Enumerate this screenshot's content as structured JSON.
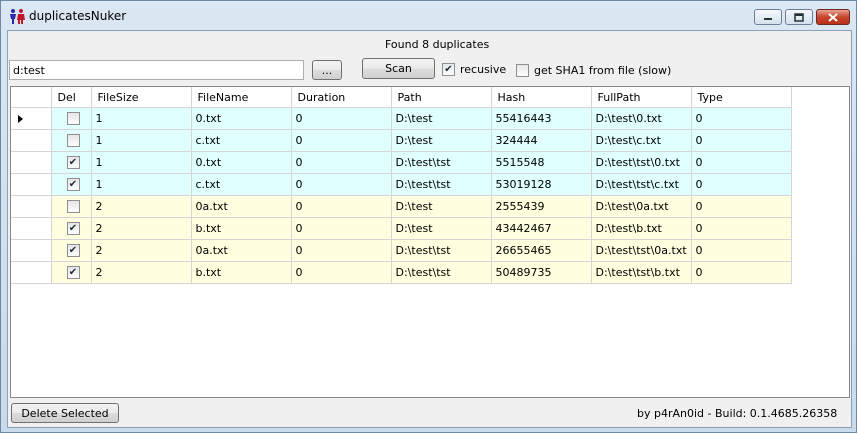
{
  "window": {
    "title": "duplicatesNuker"
  },
  "status": "Found 8 duplicates",
  "path_input": {
    "value": "d:test"
  },
  "browse_label": "...",
  "scan_label": "Scan",
  "options": {
    "recursive": {
      "label": "recusive",
      "checked": true
    },
    "sha1": {
      "label": "get SHA1 from file (slow)",
      "checked": false
    }
  },
  "grid": {
    "columns": [
      "Del",
      "FileSize",
      "FileName",
      "Duration",
      "Path",
      "Hash",
      "FullPath",
      "Type"
    ],
    "rows": [
      {
        "del": false,
        "size": "1",
        "name": "0.txt",
        "duration": "0",
        "path": "D:\\test",
        "hash": "55416443",
        "full": "D:\\test\\0.txt",
        "type": "0",
        "group": 1,
        "current": true
      },
      {
        "del": false,
        "size": "1",
        "name": "c.txt",
        "duration": "0",
        "path": "D:\\test",
        "hash": "324444",
        "full": "D:\\test\\c.txt",
        "type": "0",
        "group": 1,
        "current": false
      },
      {
        "del": true,
        "size": "1",
        "name": "0.txt",
        "duration": "0",
        "path": "D:\\test\\tst",
        "hash": "5515548",
        "full": "D:\\test\\tst\\0.txt",
        "type": "0",
        "group": 1,
        "current": false
      },
      {
        "del": true,
        "size": "1",
        "name": "c.txt",
        "duration": "0",
        "path": "D:\\test\\tst",
        "hash": "53019128",
        "full": "D:\\test\\tst\\c.txt",
        "type": "0",
        "group": 1,
        "current": false
      },
      {
        "del": false,
        "size": "2",
        "name": "0a.txt",
        "duration": "0",
        "path": "D:\\test",
        "hash": "2555439",
        "full": "D:\\test\\0a.txt",
        "type": "0",
        "group": 2,
        "current": false
      },
      {
        "del": true,
        "size": "2",
        "name": "b.txt",
        "duration": "0",
        "path": "D:\\test",
        "hash": "43442467",
        "full": "D:\\test\\b.txt",
        "type": "0",
        "group": 2,
        "current": false
      },
      {
        "del": true,
        "size": "2",
        "name": "0a.txt",
        "duration": "0",
        "path": "D:\\test\\tst",
        "hash": "26655465",
        "full": "D:\\test\\tst\\0a.txt",
        "type": "0",
        "group": 2,
        "current": false
      },
      {
        "del": true,
        "size": "2",
        "name": "b.txt",
        "duration": "0",
        "path": "D:\\test\\tst",
        "hash": "50489735",
        "full": "D:\\test\\tst\\b.txt",
        "type": "0",
        "group": 2,
        "current": false
      }
    ]
  },
  "delete_label": "Delete Selected",
  "build": "by p4rAn0id - Build: 0.1.4685.26358"
}
